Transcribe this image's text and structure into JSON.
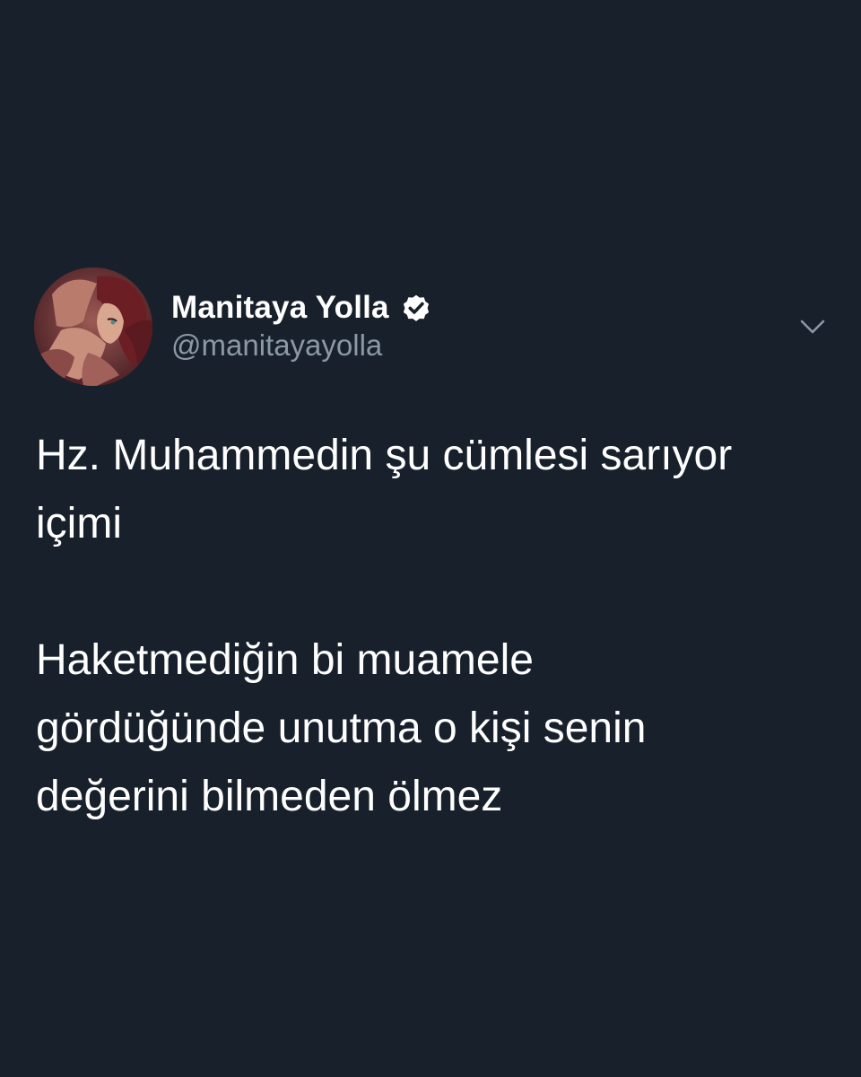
{
  "tweet": {
    "author": {
      "display_name": "Manitaya Yolla",
      "handle": "@manitayayolla",
      "verified": true,
      "avatar_icon": "avatar-illustration",
      "verified_icon": "verified-badge-icon"
    },
    "menu_icon": "chevron-down-icon",
    "paragraphs": [
      {
        "lines": [
          "Hz. Muhammedin şu cümlesi sarıyor",
          "içimi"
        ]
      },
      {
        "lines": [
          "Haketmediğin bi muamele",
          "gördüğünde unutma o kişi senin",
          "değerini bilmeden ölmez"
        ]
      }
    ]
  },
  "colors": {
    "background": "#18202b",
    "text_primary": "#ffffff",
    "text_secondary": "#8b98a5"
  }
}
